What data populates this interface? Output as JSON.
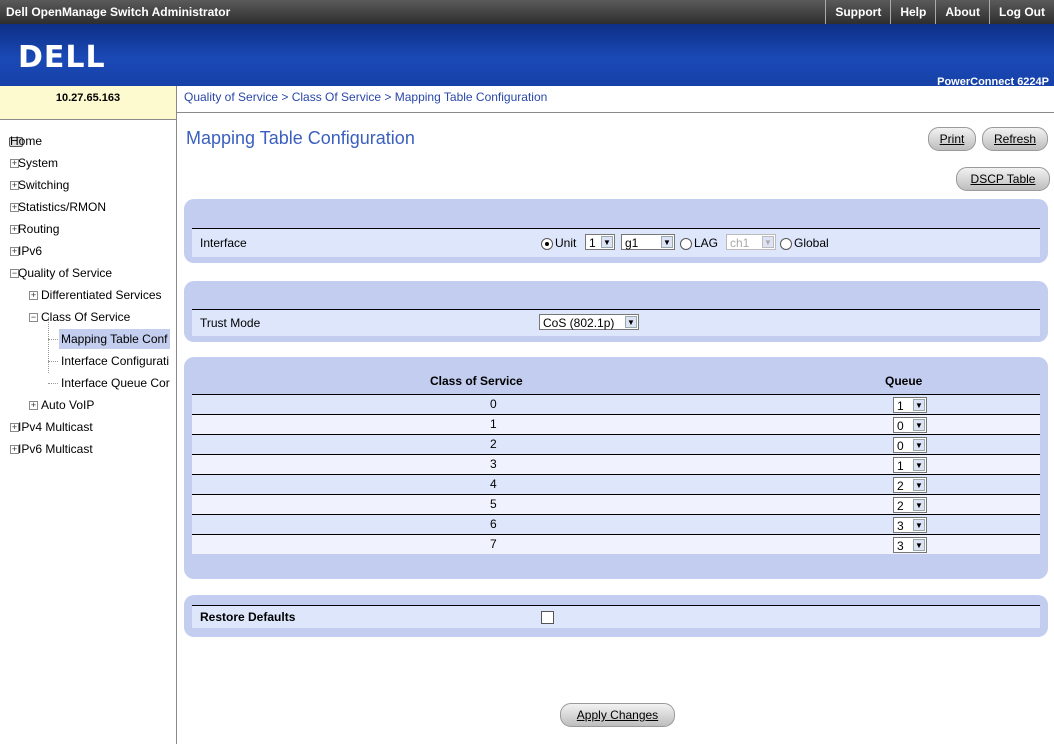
{
  "header": {
    "app_title": "Dell OpenManage Switch Administrator",
    "links": [
      "Support",
      "Help",
      "About",
      "Log Out"
    ],
    "logo": "DELL",
    "model": "PowerConnect 6224P"
  },
  "nav": {
    "ip": "10.27.65.163",
    "tree": [
      {
        "label": "Home"
      },
      {
        "label": "System"
      },
      {
        "label": "Switching"
      },
      {
        "label": "Statistics/RMON"
      },
      {
        "label": "Routing"
      },
      {
        "label": "IPv6"
      },
      {
        "label": "Quality of Service"
      },
      {
        "label": "Differentiated Services"
      },
      {
        "label": "Class Of Service"
      },
      {
        "label": "Mapping Table Conf"
      },
      {
        "label": "Interface Configurati"
      },
      {
        "label": "Interface Queue Cor"
      },
      {
        "label": "Auto VoIP"
      },
      {
        "label": "IPv4 Multicast"
      },
      {
        "label": "IPv6 Multicast"
      }
    ]
  },
  "breadcrumb": "Quality of Service > Class Of Service > Mapping Table Configuration",
  "page_title": "Mapping Table Configuration",
  "buttons": {
    "print": "Print",
    "refresh": "Refresh",
    "dscp": "DSCP Table",
    "apply": "Apply Changes"
  },
  "interface": {
    "label": "Interface",
    "unit_label": "Unit",
    "unit_value": "1",
    "port_value": "g1",
    "lag_label": "LAG",
    "lag_value": "ch1",
    "global_label": "Global"
  },
  "trust": {
    "label": "Trust Mode",
    "value": "CoS (802.1p)"
  },
  "cos_table": {
    "col_cos": "Class of Service",
    "col_queue": "Queue",
    "rows": [
      {
        "cos": "0",
        "queue": "1"
      },
      {
        "cos": "1",
        "queue": "0"
      },
      {
        "cos": "2",
        "queue": "0"
      },
      {
        "cos": "3",
        "queue": "1"
      },
      {
        "cos": "4",
        "queue": "2"
      },
      {
        "cos": "5",
        "queue": "2"
      },
      {
        "cos": "6",
        "queue": "3"
      },
      {
        "cos": "7",
        "queue": "3"
      }
    ]
  },
  "restore": {
    "label": "Restore Defaults"
  }
}
